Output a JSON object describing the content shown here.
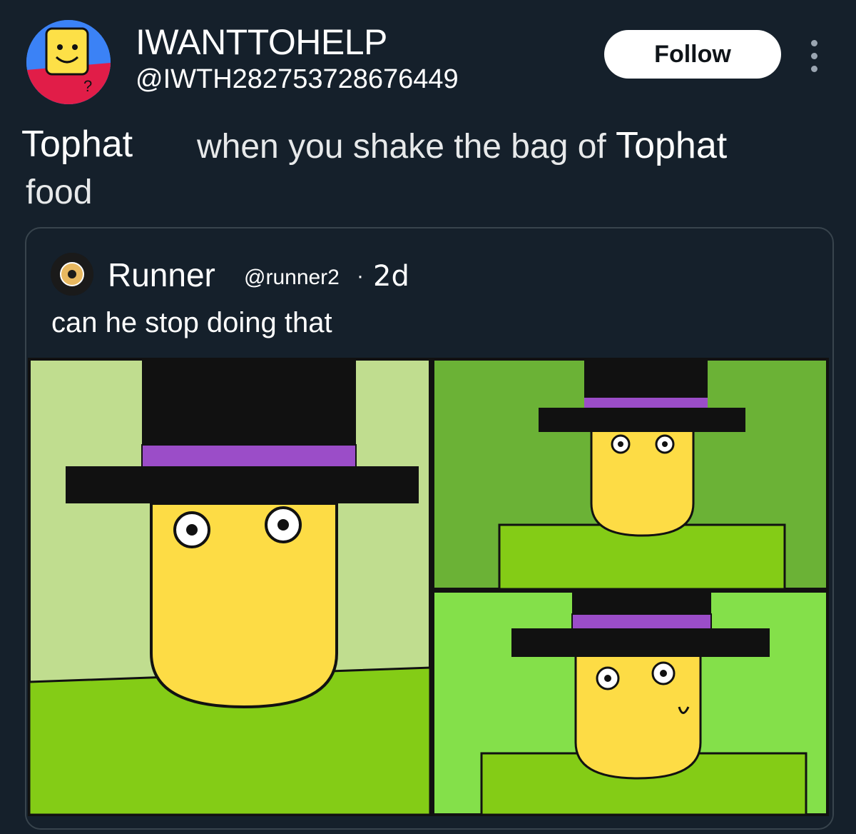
{
  "author": {
    "display_name": "IWANTTOHELP",
    "handle": "@IWTH282753728676449",
    "avatar_icon": "cartoon-smiley-avatar"
  },
  "actions": {
    "follow_label": "Follow",
    "more_icon": "more-dots-icon"
  },
  "tweet": {
    "tag_word": "Tophat",
    "text_line1_prefix": "when you shake the bag of ",
    "text_line1_bold": "Tophat",
    "text_line2": "food"
  },
  "quoted": {
    "display_name": "Runner",
    "handle": "@runner2",
    "separator": "·",
    "time": "2d",
    "text": "can he stop doing that",
    "avatar_icon": "donut-avatar"
  },
  "colors": {
    "background": "#15202b",
    "follow_bg": "#ffffff",
    "hat_band": "#9b4dc8",
    "face": "#fddc45",
    "panel_green_light": "#c0dd8f",
    "panel_green_body": "#84cc16"
  }
}
